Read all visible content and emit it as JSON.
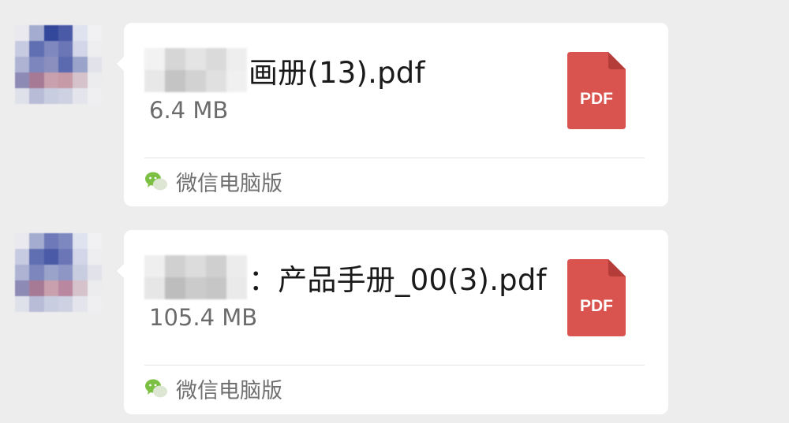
{
  "messages": [
    {
      "file_name": "画册(13).pdf",
      "file_size": "6.4 MB",
      "file_type_badge": "PDF",
      "source_label": "微信电脑版",
      "icon": "pdf-file-icon"
    },
    {
      "file_name": "产品手册_00(3).pdf",
      "file_name_prefix": "：",
      "file_size": "105.4 MB",
      "file_type_badge": "PDF",
      "source_label": "微信电脑版",
      "icon": "pdf-file-icon"
    }
  ],
  "colors": {
    "background": "#ededed",
    "bubble": "#ffffff",
    "pdf_red": "#d9534f",
    "wechat_green": "#7bc043"
  }
}
